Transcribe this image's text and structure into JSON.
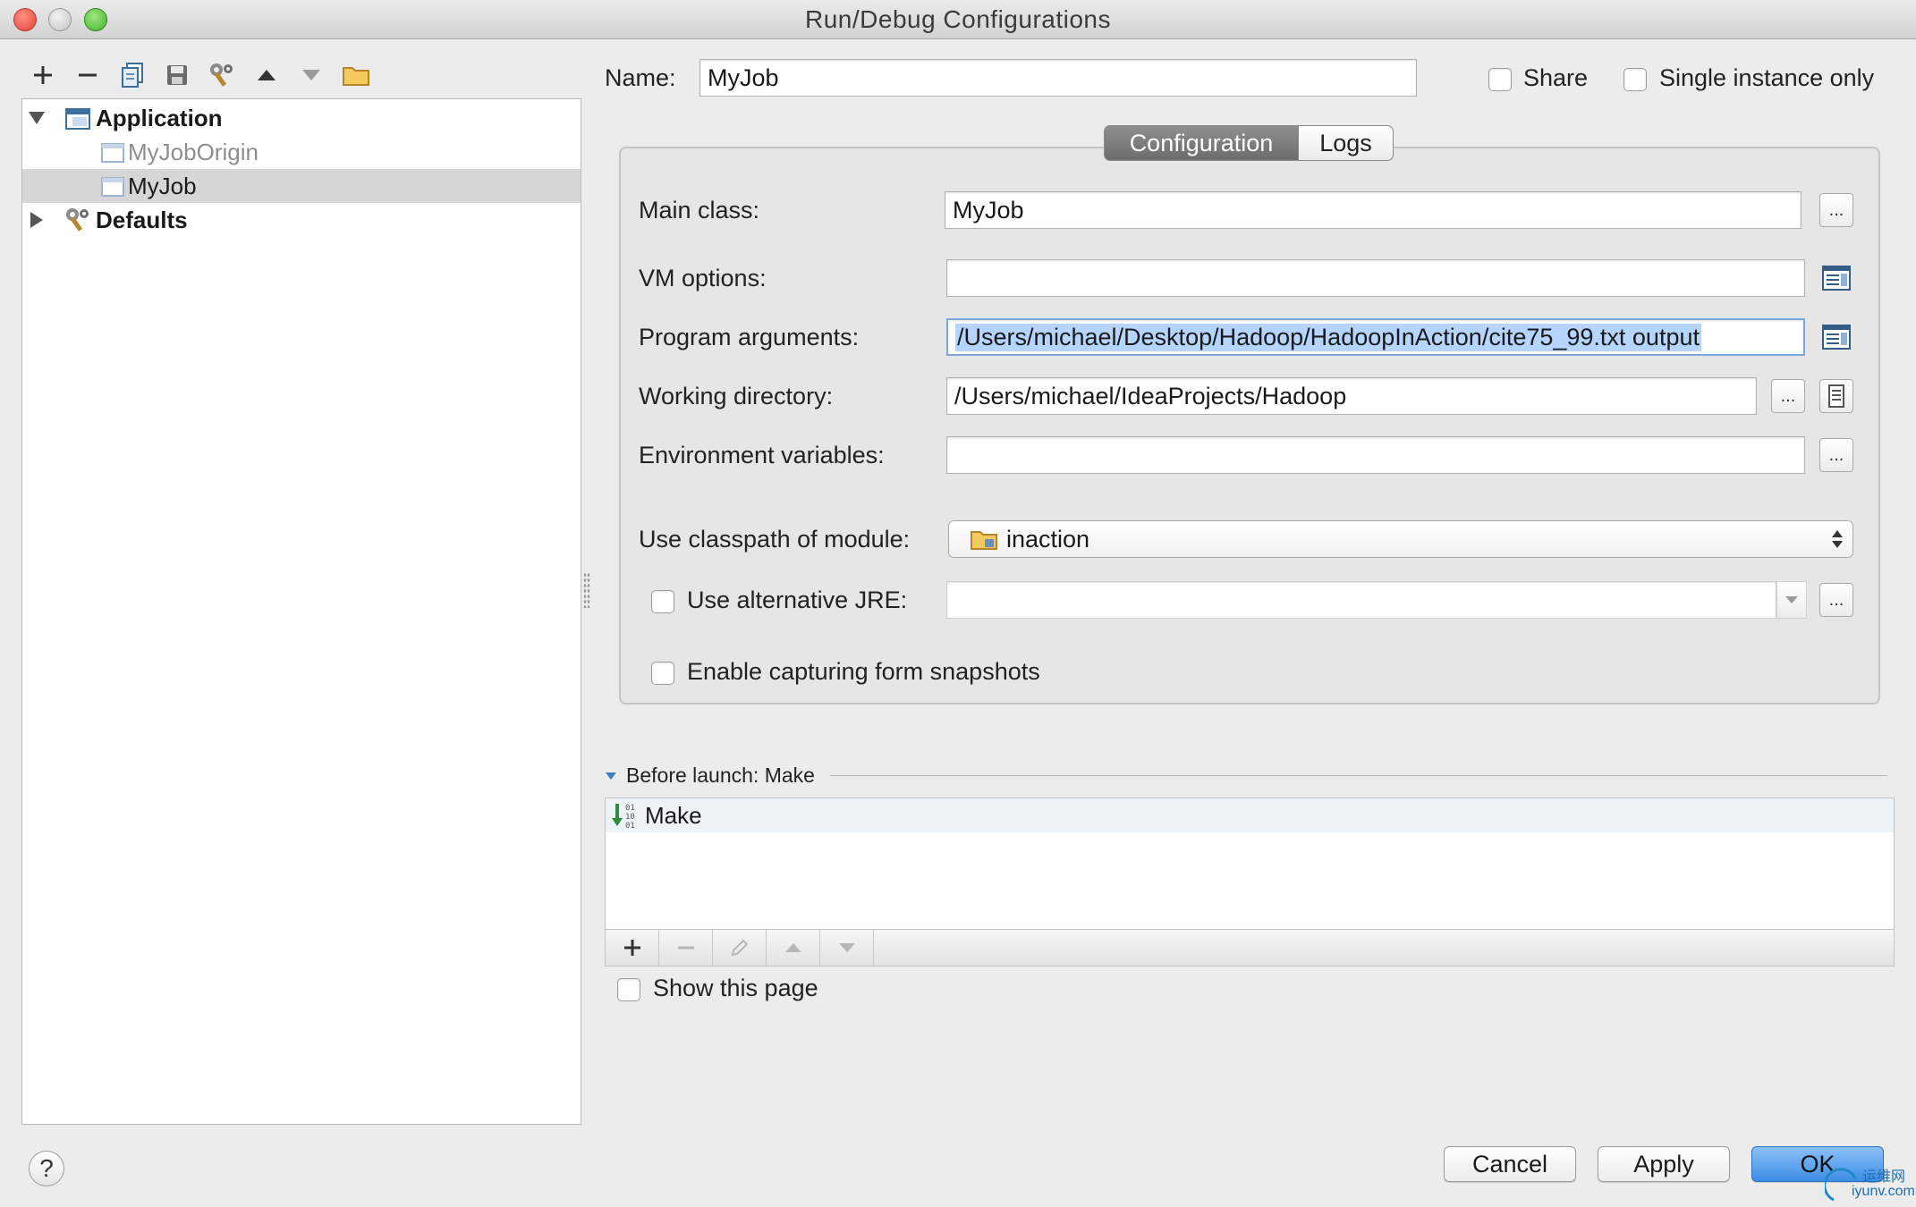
{
  "window": {
    "title": "Run/Debug Configurations"
  },
  "tree": {
    "items": [
      {
        "label": "Application",
        "bold": true,
        "expanded": true
      },
      {
        "label": "MyJobOrigin",
        "muted": true
      },
      {
        "label": "MyJob",
        "selected": true
      },
      {
        "label": "Defaults",
        "bold": true,
        "expanded": false
      }
    ]
  },
  "header": {
    "name_label": "Name:",
    "name_value": "MyJob",
    "share_label": "Share",
    "single_instance_label": "Single instance only"
  },
  "tabs": [
    {
      "label": "Configuration",
      "active": true
    },
    {
      "label": "Logs",
      "active": false
    }
  ],
  "form": {
    "main_class_label": "Main class:",
    "main_class_value": "MyJob",
    "vm_options_label": "VM options:",
    "vm_options_value": "",
    "program_args_label": "Program arguments:",
    "program_args_value": "/Users/michael/Desktop/Hadoop/HadoopInAction/cite75_99.txt output",
    "working_dir_label": "Working directory:",
    "working_dir_value": "/Users/michael/IdeaProjects/Hadoop",
    "env_vars_label": "Environment variables:",
    "env_vars_value": "",
    "classpath_label": "Use classpath of module:",
    "classpath_value": "inaction",
    "alt_jre_label": "Use alternative JRE:",
    "alt_jre_value": "",
    "snapshots_label": "Enable capturing form snapshots",
    "ellipsis": "..."
  },
  "before_launch": {
    "header": "Before launch: Make",
    "items": [
      {
        "label": "Make"
      }
    ],
    "show_page_label": "Show this page"
  },
  "buttons": {
    "help": "?",
    "cancel": "Cancel",
    "apply": "Apply",
    "ok": "OK"
  },
  "watermark": {
    "line1": "运维网",
    "line2": "iyunv.com"
  },
  "colors": {
    "selection": "#b5d5ff",
    "default_button": "#3d8ee8",
    "tree_selected": "#d6d6d6"
  }
}
